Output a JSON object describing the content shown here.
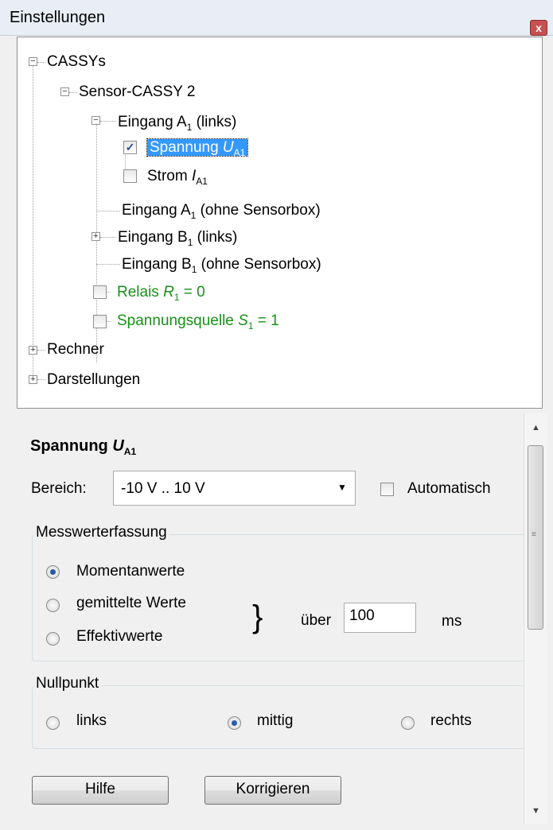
{
  "window": {
    "title": "Einstellungen",
    "close_glyph": "x"
  },
  "tree": {
    "n_cassys": "CASSYs",
    "n_sensor": "Sensor-CASSY 2",
    "n_eingA": {
      "pre": "Eingang A",
      "sub": "1",
      "post": " (links)"
    },
    "n_spannung": {
      "pre": "Spannung ",
      "ital": "U",
      "sub": "A1"
    },
    "n_strom": {
      "pre": "Strom ",
      "ital": "I",
      "sub": "A1"
    },
    "n_eingA2": {
      "pre": "Eingang A",
      "sub": "1",
      "post": " (ohne Sensorbox)"
    },
    "n_eingB": {
      "pre": "Eingang B",
      "sub": "1",
      "post": " (links)"
    },
    "n_eingB2": {
      "pre": "Eingang B",
      "sub": "1",
      "post": " (ohne Sensorbox)"
    },
    "n_relais": {
      "pre": "Relais ",
      "ital": "R",
      "sub": "1",
      "post": " = 0"
    },
    "n_quelle": {
      "pre": "Spannungsquelle ",
      "ital": "S",
      "sub": "1",
      "post": " = 1"
    },
    "n_rechner": "Rechner",
    "n_darst": "Darstellungen"
  },
  "props": {
    "heading": {
      "pre": "Spannung ",
      "ital": "U",
      "sub": "A1"
    },
    "bereich_label": "Bereich:",
    "bereich_value": "-10 V .. 10 V",
    "automatisch_label": "Automatisch",
    "mess_title": "Messwerterfassung",
    "radio_momentan": "Momentanwerte",
    "radio_gemittelt": "gemittelte Werte",
    "radio_effektiv": "Effektivwerte",
    "brace": "}",
    "ueber_label": "über",
    "ueber_value": "100",
    "ms_label": "ms",
    "null_title": "Nullpunkt",
    "radio_links": "links",
    "radio_mittig": "mittig",
    "radio_rechts": "rechts",
    "hilfe_button": "Hilfe",
    "korrigieren_button": "Korrigieren"
  },
  "colors": {
    "selection": "#3399ff",
    "green_text": "#169216"
  }
}
